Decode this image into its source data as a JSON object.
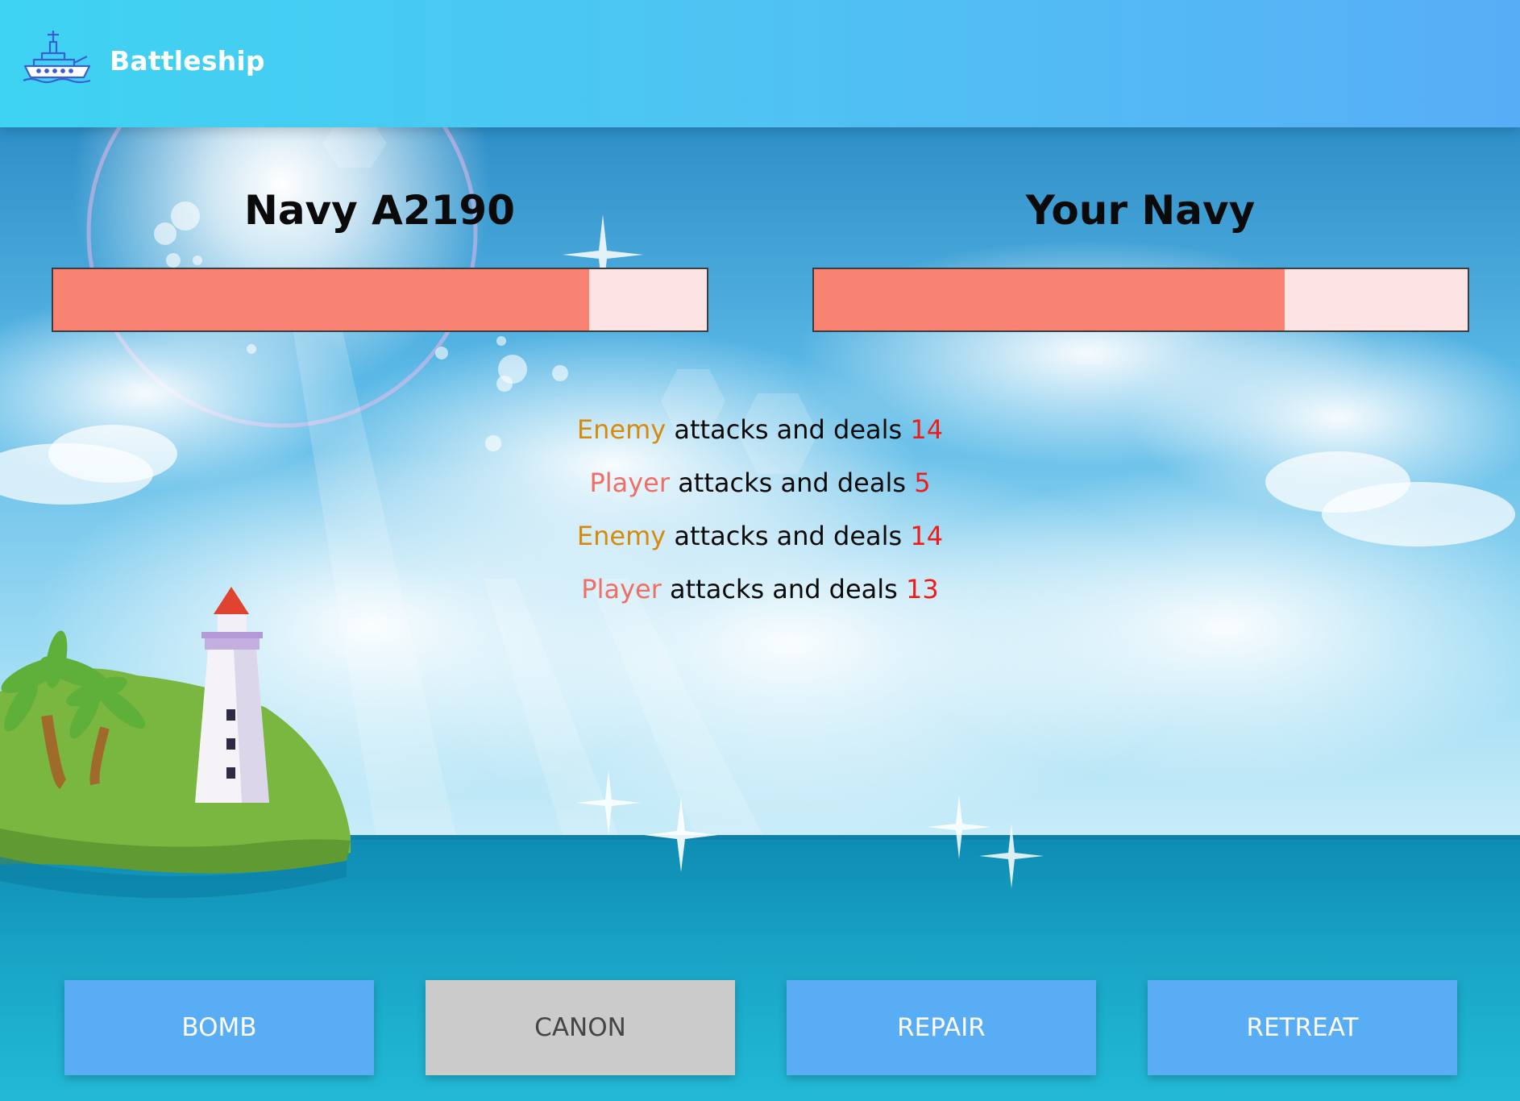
{
  "header": {
    "title": "Battleship",
    "icon": "battleship-icon",
    "gradient": [
      "#3ed3f2",
      "#58aef6"
    ]
  },
  "enemy": {
    "name": "Navy A2190",
    "health_percent": 82
  },
  "player": {
    "name": "Your Navy",
    "health_percent": 72
  },
  "colors": {
    "health_fill": "#f88373",
    "health_empty": "#fce4e4",
    "enemy_actor": "#d68a0e",
    "player_actor": "#ef6f66",
    "damage": "#ef1c1c",
    "button_active": "#58adf5",
    "button_disabled": "#cbcbcb"
  },
  "log": [
    {
      "actor": "Enemy",
      "text": " attacks and deals ",
      "damage": "14"
    },
    {
      "actor": "Player",
      "text": " attacks and deals ",
      "damage": "5"
    },
    {
      "actor": "Enemy",
      "text": " attacks and deals ",
      "damage": "14"
    },
    {
      "actor": "Player",
      "text": " attacks and deals ",
      "damage": "13"
    }
  ],
  "actions": {
    "bomb": "BOMB",
    "canon": "CANON",
    "repair": "REPAIR",
    "retreat": "RETREAT"
  }
}
